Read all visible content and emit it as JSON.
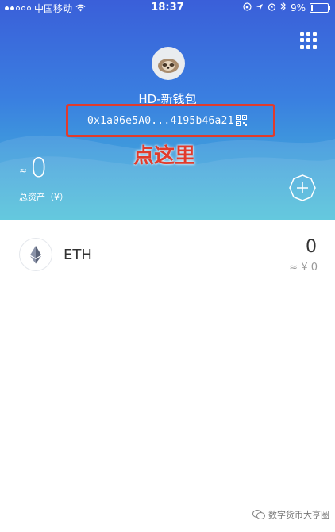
{
  "status_bar": {
    "carrier": "中国移动",
    "time": "18:37",
    "battery": "9%"
  },
  "wallet": {
    "name": "HD-新钱包",
    "address": "0x1a06e5A0...4195b46a21"
  },
  "annotation": "点这里",
  "total_assets": {
    "approx": "≈",
    "value": "0",
    "label": "总资产（¥）"
  },
  "tokens": [
    {
      "symbol": "ETH",
      "amount": "0",
      "fiat": "≈ ¥ 0"
    }
  ],
  "watermark": "数字货币大亨圈",
  "colors": {
    "header_top": "#3a5fd9",
    "header_bottom": "#45bfd8",
    "annotation": "#e13b2c"
  }
}
